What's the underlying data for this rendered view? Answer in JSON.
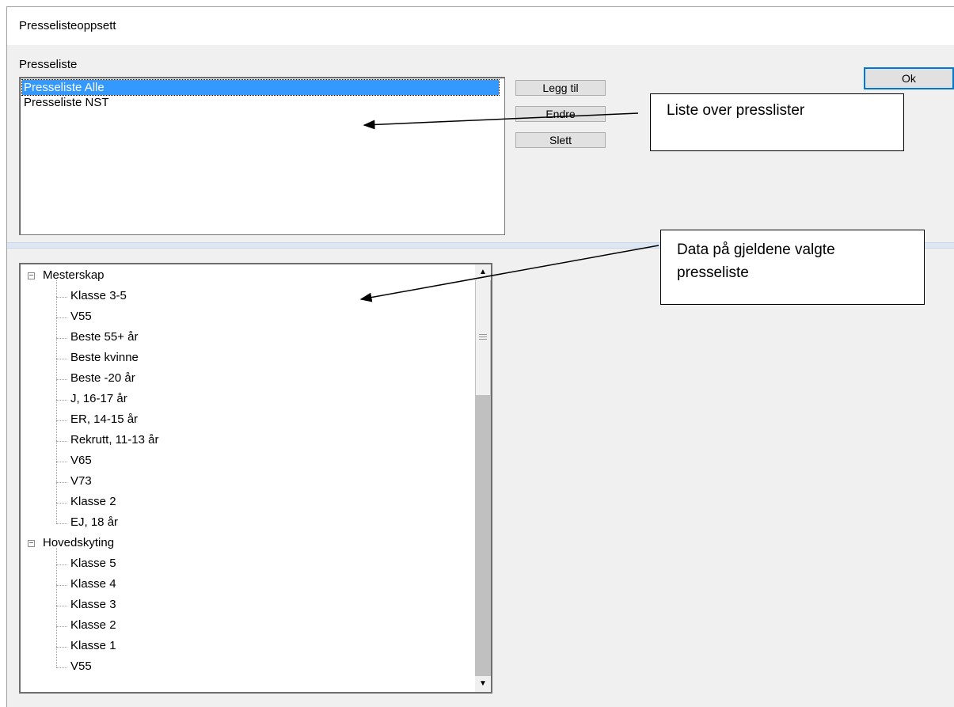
{
  "window": {
    "title": "Presselisteoppsett"
  },
  "presseliste": {
    "label": "Presseliste",
    "items": [
      {
        "label": "Presseliste Alle",
        "selected": true
      },
      {
        "label": "Presseliste NST",
        "selected": false
      }
    ]
  },
  "buttons": {
    "add": "Legg til",
    "edit": "Endre",
    "delete": "Slett",
    "ok": "Ok"
  },
  "tree": {
    "groups": [
      {
        "label": "Mesterskap",
        "expander": "−",
        "children": [
          "Klasse 3-5",
          "V55",
          "Beste 55+ år",
          "Beste kvinne",
          "Beste -20 år",
          "J, 16-17 år",
          "ER, 14-15 år",
          "Rekrutt, 11-13 år",
          "V65",
          "V73",
          "Klasse 2",
          "EJ, 18 år"
        ]
      },
      {
        "label": "Hovedskyting",
        "expander": "−",
        "children": [
          "Klasse 5",
          "Klasse 4",
          "Klasse 3",
          "Klasse 2",
          "Klasse 1",
          "V55"
        ]
      }
    ]
  },
  "annotations": {
    "list_callout": "Liste over presslister",
    "data_callout": "Data på gjeldene valgte presseliste"
  },
  "scrollbar": {
    "up_icon": "▲",
    "down_icon": "▼"
  },
  "colors": {
    "selection": "#3399ff",
    "ok_border": "#0078d7"
  }
}
